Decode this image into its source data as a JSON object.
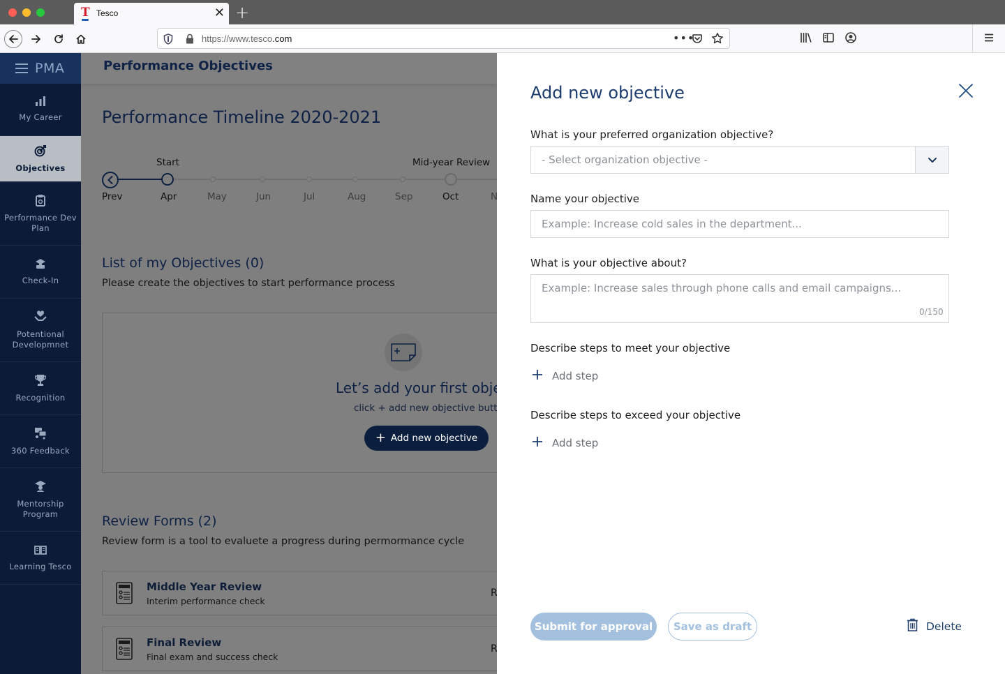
{
  "browser": {
    "tab_title": "Tesco",
    "tab_logo": "T",
    "url_prefix": "https://www.tesco",
    "url_domain": ".com",
    "new_tab": "+",
    "tab_close": "✕",
    "url_more": "•••"
  },
  "sidebar": {
    "brand": "PMA",
    "items": [
      {
        "label": "My Career",
        "icon": "bar-chart-icon"
      },
      {
        "label": "Objectives",
        "icon": "target-icon",
        "active": true
      },
      {
        "label": "Performance Dev Plan",
        "icon": "clipboard-icon"
      },
      {
        "label": "Check-In",
        "icon": "check-in-icon"
      },
      {
        "label": "Potentional Developmnet",
        "icon": "heart-hands-icon"
      },
      {
        "label": "Recognition",
        "icon": "trophy-icon"
      },
      {
        "label": "360 Feedback",
        "icon": "feedback-icon"
      },
      {
        "label": "Mentorship Program",
        "icon": "mentor-icon"
      },
      {
        "label": "Learning Tesco",
        "icon": "book-icon"
      }
    ]
  },
  "main": {
    "header_title": "Performance Objectives",
    "timeline": {
      "title": "Performance Timeline 2020-2021",
      "prev_label": "Prev",
      "start_label": "Start",
      "midyear_label": "Mid-year Review",
      "months": [
        "Apr",
        "May",
        "Jun",
        "Jul",
        "Aug",
        "Sep",
        "Oct",
        "N"
      ]
    },
    "objectives": {
      "title": "List of my Objectives (0)",
      "subtitle": "Please create the objectives to start performance process",
      "empty_title": "Let’s add your first objective",
      "empty_subtitle": "click + add new objective button",
      "add_button": "Add new objective"
    },
    "review_forms": {
      "title": "Review Forms (2)",
      "subtitle": "Review form is a tool to evaluete a progress during permormance cycle",
      "items": [
        {
          "title": "Middle Year Review",
          "subtitle": "Interim performance check",
          "right": "R"
        },
        {
          "title": "Final Review",
          "subtitle": "Final exam and success check",
          "right": "Re"
        }
      ]
    }
  },
  "drawer": {
    "title": "Add new objective",
    "org_label": "What is your preferred organization objective?",
    "org_placeholder": "- Select organization objective -",
    "name_label": "Name your objective",
    "name_placeholder": "Example: Increase cold sales in the department...",
    "about_label": "What is your objective about?",
    "about_placeholder": "Example: Increase sales through phone calls and email campaigns...",
    "about_counter": "0/150",
    "meet_label": "Describe steps to meet your objective",
    "exceed_label": "Describe steps to exceed your objective",
    "add_step_label": "Add step",
    "submit_label": "Submit for approval",
    "draft_label": "Save as draft",
    "delete_label": "Delete"
  },
  "colors": {
    "navy": "#0c1c38",
    "drawer_title": "#1d3c6e",
    "disabled_button": "#a3c0df",
    "overlay": "#7f7f7f"
  }
}
